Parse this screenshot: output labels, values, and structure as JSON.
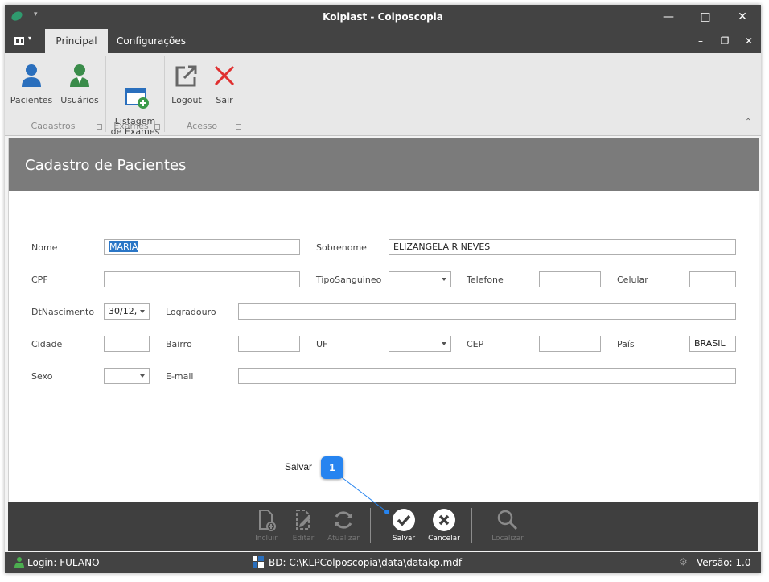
{
  "window": {
    "title": "Kolplast - Colposcopia",
    "quick_access_caret": "▾"
  },
  "tabs": [
    {
      "label": "Principal",
      "active": true
    },
    {
      "label": "Configurações",
      "active": false
    }
  ],
  "ribbon": {
    "groups": [
      {
        "label": "Cadastros",
        "buttons": [
          {
            "label": "Pacientes",
            "icon": "user-icon"
          },
          {
            "label": "Usuários",
            "icon": "user-green-icon"
          }
        ]
      },
      {
        "label": "Exames",
        "buttons": [
          {
            "label": "Listagem\nde Exames",
            "icon": "add-window-icon"
          }
        ]
      },
      {
        "label": "Acesso",
        "buttons": [
          {
            "label": "Logout",
            "icon": "logout-icon"
          },
          {
            "label": "Sair",
            "icon": "close-red-icon"
          }
        ]
      }
    ]
  },
  "form": {
    "title": "Cadastro de Pacientes",
    "fields": {
      "nome": {
        "label": "Nome",
        "value": "MARIA"
      },
      "sobrenome": {
        "label": "Sobrenome",
        "value": "ELIZANGELA R NEVES"
      },
      "cpf": {
        "label": "CPF",
        "value": ""
      },
      "tiposanguineo": {
        "label": "TipoSanguineo",
        "value": ""
      },
      "telefone": {
        "label": "Telefone",
        "value": ""
      },
      "celular": {
        "label": "Celular",
        "value": ""
      },
      "dtnascimento": {
        "label": "DtNascimento",
        "value": "30/12,"
      },
      "logradouro": {
        "label": "Logradouro",
        "value": ""
      },
      "cidade": {
        "label": "Cidade",
        "value": ""
      },
      "bairro": {
        "label": "Bairro",
        "value": ""
      },
      "uf": {
        "label": "UF",
        "value": ""
      },
      "cep": {
        "label": "CEP",
        "value": ""
      },
      "pais": {
        "label": "País",
        "value": "BRASIL"
      },
      "sexo": {
        "label": "Sexo",
        "value": ""
      },
      "email": {
        "label": "E-mail",
        "value": ""
      }
    }
  },
  "toolbar": {
    "buttons": [
      {
        "label": "Incluir",
        "enabled": false,
        "icon": "add-document-icon"
      },
      {
        "label": "Editar",
        "enabled": false,
        "icon": "edit-document-icon"
      },
      {
        "label": "Atualizar",
        "enabled": false,
        "icon": "refresh-icon"
      },
      {
        "label": "Salvar",
        "enabled": true,
        "icon": "check-circle-icon"
      },
      {
        "label": "Cancelar",
        "enabled": true,
        "icon": "x-circle-icon"
      },
      {
        "label": "Localizar",
        "enabled": false,
        "icon": "search-icon"
      }
    ]
  },
  "callout": {
    "label": "Salvar",
    "number": "1",
    "color": "#2684f0"
  },
  "status": {
    "login": "Login: FULANO",
    "database": "BD: C:\\KLPColposcopia\\data\\datakp.mdf",
    "version": "Versão: 1.0"
  }
}
